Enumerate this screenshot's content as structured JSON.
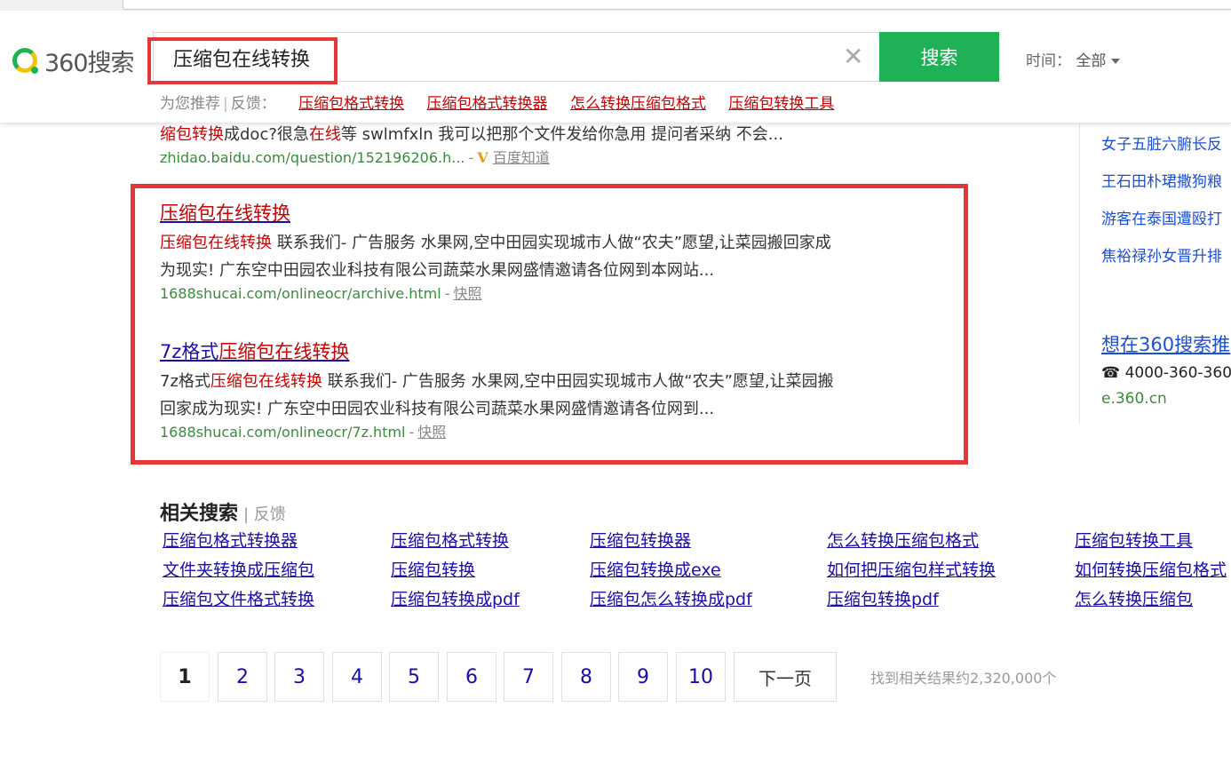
{
  "search": {
    "logo_text": "360搜索",
    "query": "压缩包在线转换",
    "button_label": "搜索",
    "time_label": "时间：",
    "time_value": "全部"
  },
  "recommend": {
    "prefix": "为您推荐",
    "sep": "|",
    "feedback": "反馈：",
    "links": [
      "压缩包格式转换",
      "压缩包格式转换器",
      "怎么转换压缩包格式",
      "压缩包转换工具"
    ]
  },
  "partial_result": {
    "snippet_em1": "缩包转换",
    "snippet_t1": "成doc?很急",
    "snippet_em2": "在线",
    "snippet_t2": "等 swlmfxln 我可以把那个文件发给你急用 提问者采纳 不会...",
    "url": "zhidao.baidu.com/question/152196206.h...",
    "dash": "-",
    "v": "V",
    "source": "百度知道"
  },
  "results": [
    {
      "title_em": "压缩包在线转换",
      "snippet_em": "压缩包在线转换",
      "snippet_line1_rest": " 联系我们- 广告服务 水果网,空中田园实现城市人做“农夫”愿望,让菜园搬回家成",
      "snippet_line2": "为现实! 广东空中田园农业科技有限公司蔬菜水果网盛情邀请各位网到本网站...",
      "url": "1688shucai.com/onlineocr/archive.html",
      "dash": "-",
      "snapshot": "快照"
    },
    {
      "title_plain": "7z格式",
      "title_em": "压缩包在线转换",
      "snippet_plain": "7z格式",
      "snippet_em": "压缩包在线转换",
      "snippet_line1_rest": " 联系我们- 广告服务 水果网,空中田园实现城市人做“农夫”愿望,让菜园搬",
      "snippet_line2": "回家成为现实! 广东空中田园农业科技有限公司蔬菜水果网盛情邀请各位网到...",
      "url": "1688shucai.com/onlineocr/7z.html",
      "dash": "-",
      "snapshot": "快照"
    }
  ],
  "right": {
    "news": [
      "女子五脏六腑长反",
      "王石田朴珺撒狗粮",
      "游客在泰国遭殴打",
      "焦裕禄孙女晋升排"
    ],
    "ad_title": "想在360搜索推",
    "ad_phone": "☎ 4000-360-360",
    "ad_site": "e.360.cn"
  },
  "related": {
    "title": "相关搜索",
    "feedback": "| 反馈",
    "rows": [
      [
        "压缩包格式转换器",
        "压缩包格式转换",
        "压缩包转换器",
        "怎么转换压缩包格式",
        "压缩包转换工具"
      ],
      [
        "文件夹转换成压缩包",
        "压缩包转换",
        "压缩包转换成exe",
        "如何把压缩包样式转换",
        "如何转换压缩包格式"
      ],
      [
        "压缩包文件格式转换",
        "压缩包转换成pdf",
        "压缩包怎么转换成pdf",
        "压缩包转换pdf",
        "怎么转换压缩包"
      ]
    ]
  },
  "pager": {
    "pages": [
      "1",
      "2",
      "3",
      "4",
      "5",
      "6",
      "7",
      "8",
      "9",
      "10"
    ],
    "current": "1",
    "next": "下一页",
    "total": "找到相关结果约2,320,000个"
  },
  "colors": {
    "accent_green": "#1eb156",
    "highlight_red": "#e5363a",
    "link_blue": "#1a0dab",
    "em_red": "#c00"
  }
}
